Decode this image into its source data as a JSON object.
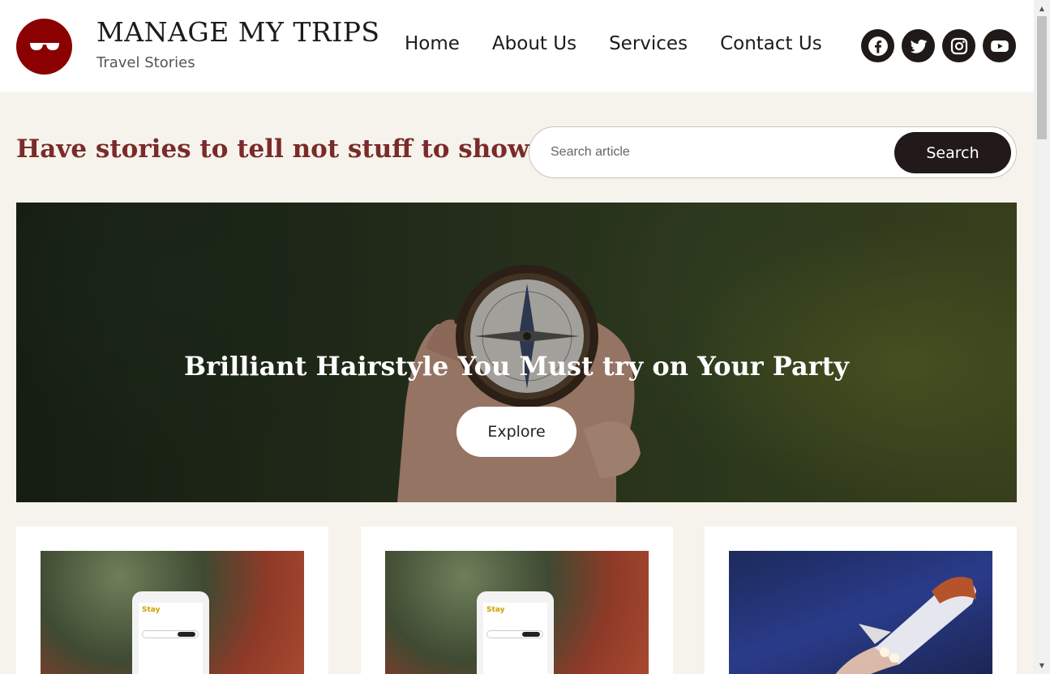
{
  "header": {
    "site_title": "MANAGE MY TRIPS",
    "site_tagline": "Travel Stories",
    "logo_icon": "sunglasses-icon",
    "logo_color": "#8b0000"
  },
  "nav": {
    "items": [
      {
        "label": "Home"
      },
      {
        "label": "About Us"
      },
      {
        "label": "Services"
      },
      {
        "label": "Contact Us"
      }
    ]
  },
  "social": {
    "icons": [
      "facebook-icon",
      "twitter-icon",
      "instagram-icon",
      "youtube-icon"
    ]
  },
  "hero": {
    "tagline": "Have stories to tell not stuff to show",
    "tagline_color": "#7b2a2a"
  },
  "search": {
    "placeholder": "Search article",
    "value": "",
    "button_label": "Search"
  },
  "banner": {
    "title": "Brilliant Hairstyle You Must try on Your Party",
    "button_label": "Explore"
  },
  "cards": [
    {
      "image": "phone-app-photo",
      "phone_logo": "Stay"
    },
    {
      "image": "phone-app-photo",
      "phone_logo": "Stay"
    },
    {
      "image": "space-shuttle-photo"
    }
  ]
}
